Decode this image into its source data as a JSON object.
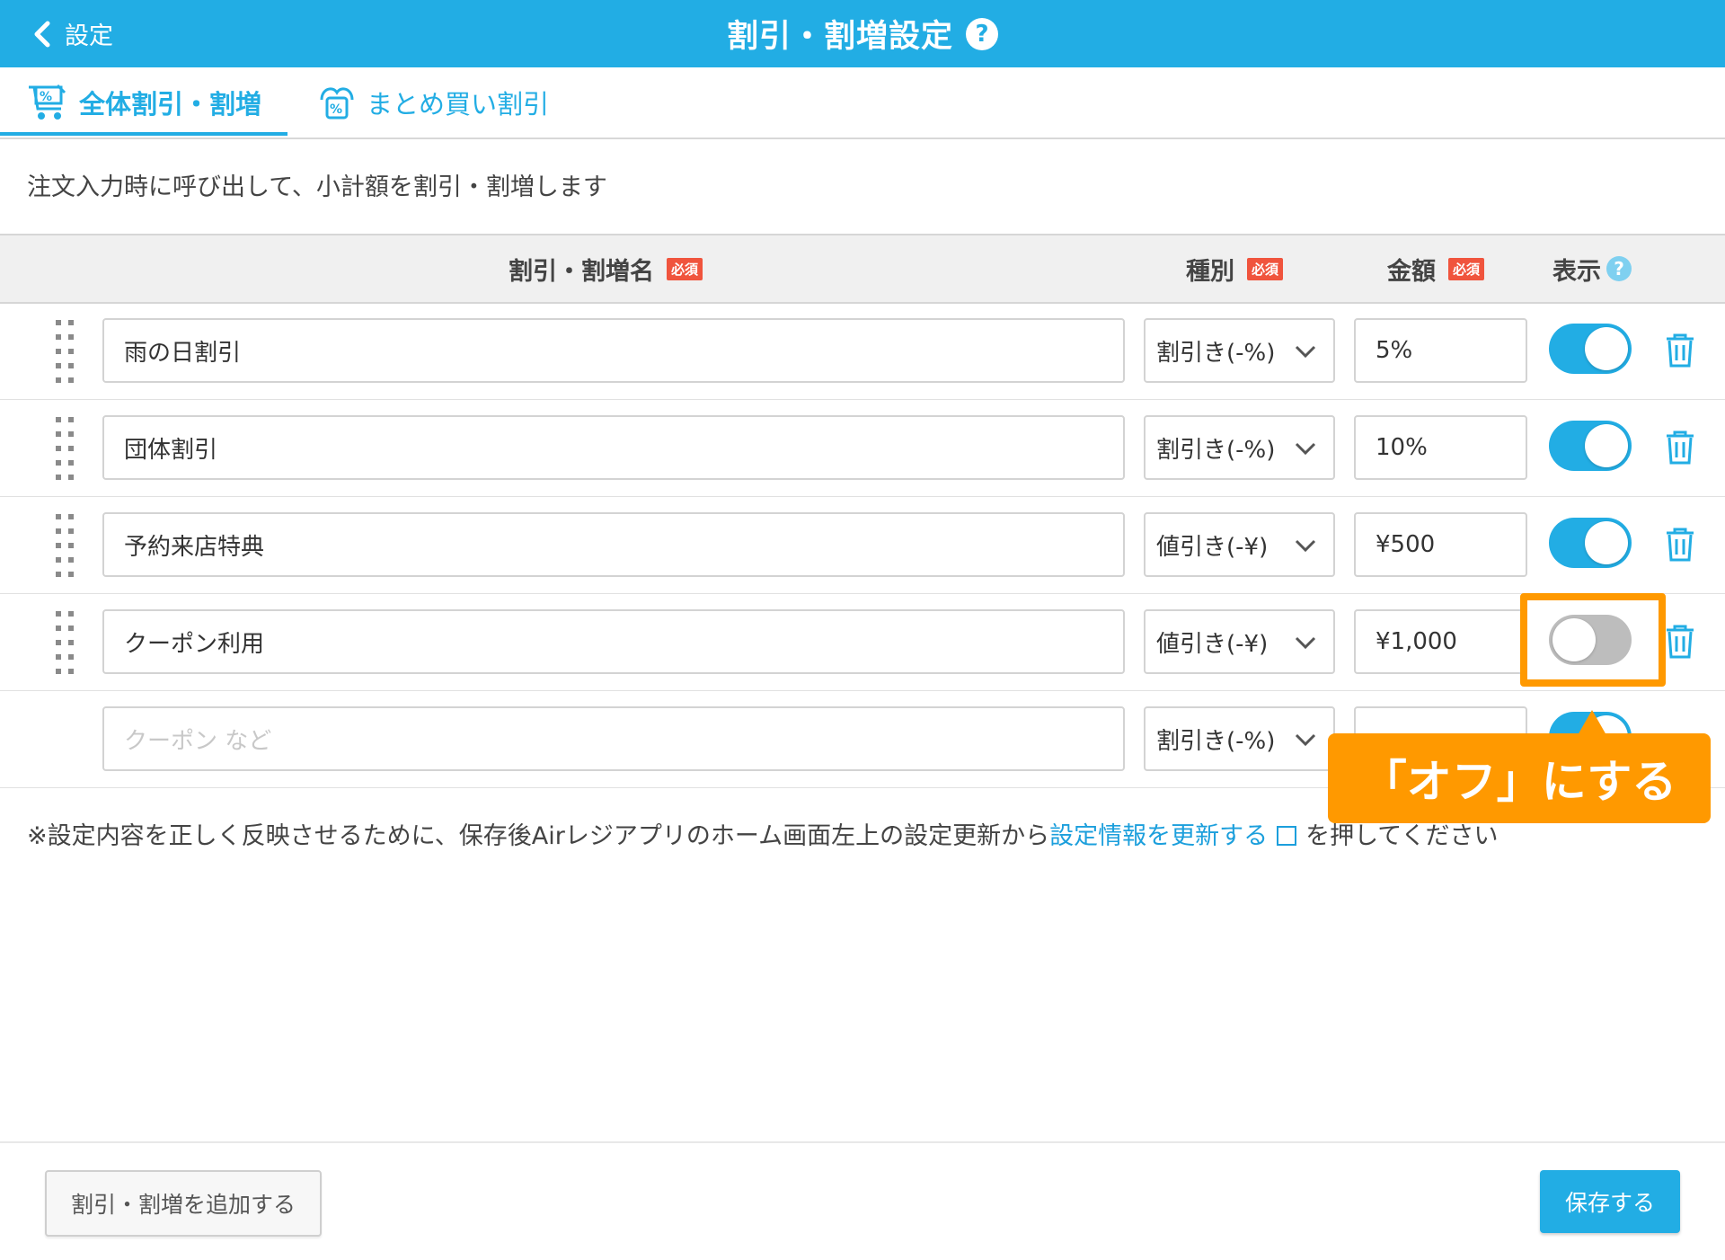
{
  "header": {
    "back_label": "設定",
    "title": "割引・割増設定",
    "help_mark": "?"
  },
  "tabs": [
    {
      "label": "全体割引・割増",
      "active": true
    },
    {
      "label": "まとめ買い割引",
      "active": false
    }
  ],
  "description": "注文入力時に呼び出して、小計額を割引・割増します",
  "table": {
    "columns": {
      "name": "割引・割増名",
      "type": "種別",
      "amount": "金額",
      "display": "表示",
      "required_badge": "必須",
      "help_mark": "?"
    },
    "rows": [
      {
        "name": "雨の日割引",
        "type": "割引き(-%)",
        "amount": "5%",
        "display_on": true
      },
      {
        "name": "団体割引",
        "type": "割引き(-%)",
        "amount": "10%",
        "display_on": true
      },
      {
        "name": "予約来店特典",
        "type": "値引き(-¥)",
        "amount": "¥500",
        "display_on": true
      },
      {
        "name": "クーポン利用",
        "type": "値引き(-¥)",
        "amount": "¥1,000",
        "display_on": false
      }
    ],
    "new_row": {
      "name_placeholder": "クーポン など",
      "type": "割引き(-%)",
      "display_on": true
    }
  },
  "callout": "「オフ」にする",
  "note": {
    "prefix": "※設定内容を正しく反映させるために、保存後Airレジアプリのホーム画面左上の設定更新から",
    "link": "設定情報を更新する",
    "suffix": "を押してください"
  },
  "footer": {
    "add_button": "割引・割増を追加する",
    "save_button": "保存する"
  },
  "colors": {
    "brand": "#22ade4",
    "required": "#f0543d",
    "highlight": "#ff9900"
  }
}
